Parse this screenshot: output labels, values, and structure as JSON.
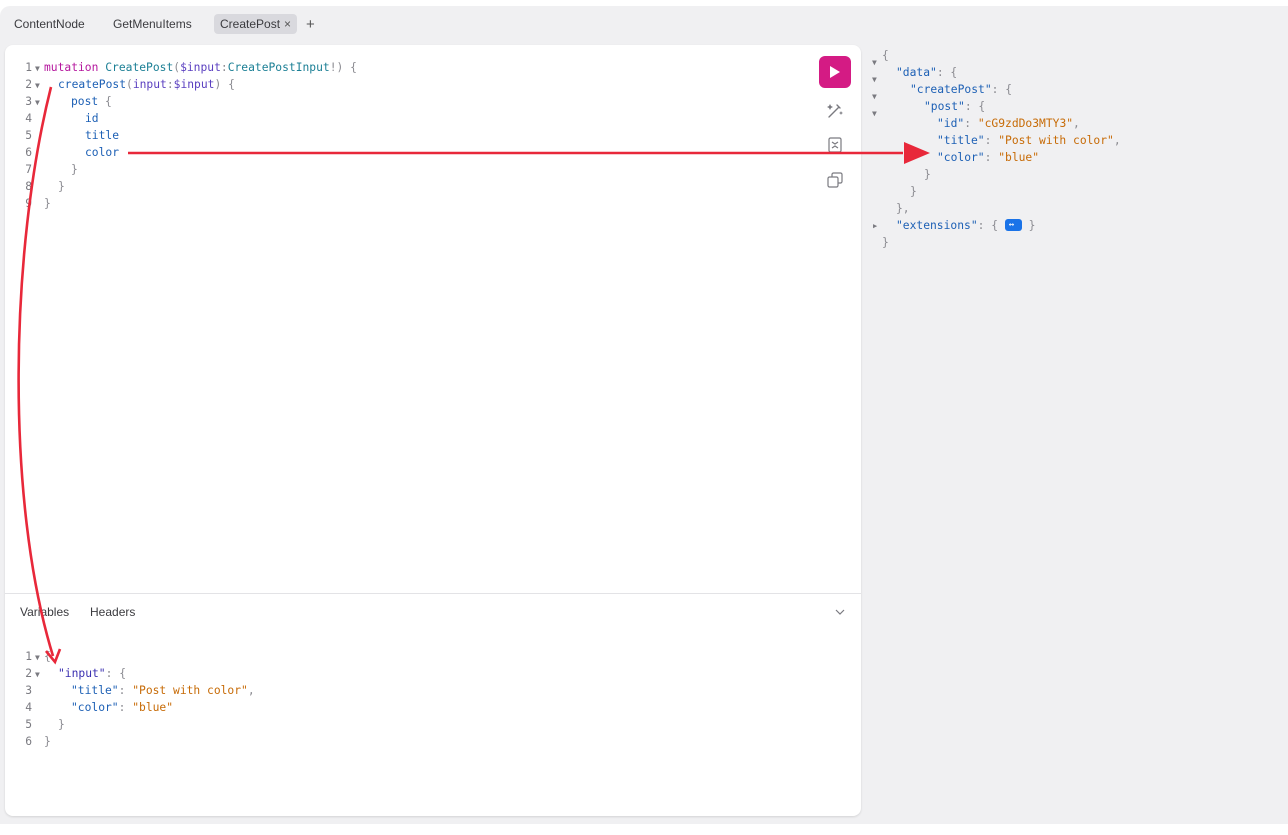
{
  "tabs": [
    {
      "label": "ContentNode"
    },
    {
      "label": "GetMenuItems"
    },
    {
      "label": "CreatePost",
      "close": "×"
    }
  ],
  "add_tab": "+",
  "query_editor": {
    "line_numbers": [
      "1",
      "2",
      "3",
      "4",
      "5",
      "6",
      "7",
      "8",
      "9"
    ],
    "line1": {
      "kw": "mutation",
      "name": "CreatePost",
      "p1": "(",
      "var": "$input",
      "colon": ":",
      "type": "CreatePostInput",
      "p2": "!) {"
    },
    "line2": {
      "field": "createPost",
      "p1": "(",
      "arg": "input",
      "colon": ":",
      "var": "$input",
      "p2": ") {"
    },
    "line3": {
      "field": "post",
      "p": " {"
    },
    "line4": {
      "field": "id"
    },
    "line5": {
      "field": "title"
    },
    "line6": {
      "field": "color"
    },
    "line7": "}",
    "line8": "}",
    "line9": "}"
  },
  "toolbar": {
    "run": "run-button",
    "prettify": "prettify-icon",
    "merge": "merge-fragments-icon",
    "copy": "copy-icon"
  },
  "bottom_tabs": {
    "variables": "Variables",
    "headers": "Headers"
  },
  "variables_editor": {
    "line_numbers": [
      "1",
      "2",
      "3",
      "4",
      "5",
      "6"
    ],
    "line1": "{",
    "line2": {
      "key": "\"input\"",
      "rest": ": {"
    },
    "line3": {
      "key": "\"title\"",
      "colon": ": ",
      "value": "\"Post with color\"",
      "comma": ","
    },
    "line4": {
      "key": "\"color\"",
      "colon": ": ",
      "value": "\"blue\""
    },
    "line5": "}",
    "line6": "}"
  },
  "response": {
    "open": "{",
    "data_key": "\"data\"",
    "createPost_key": "\"createPost\"",
    "post_key": "\"post\"",
    "id_key": "\"id\"",
    "id_value": "\"cG9zdDo3MTY3\"",
    "title_key": "\"title\"",
    "title_value": "\"Post with color\"",
    "color_key": "\"color\"",
    "color_value": "\"blue\"",
    "close_post": "}",
    "close_createPost": "}",
    "close_data": "},",
    "extensions_key": "\"extensions\"",
    "close": "}"
  },
  "colors": {
    "accent": "#d41b84",
    "annotation_arrow": "#e8283a",
    "extensions_button": "#1a73e8"
  }
}
